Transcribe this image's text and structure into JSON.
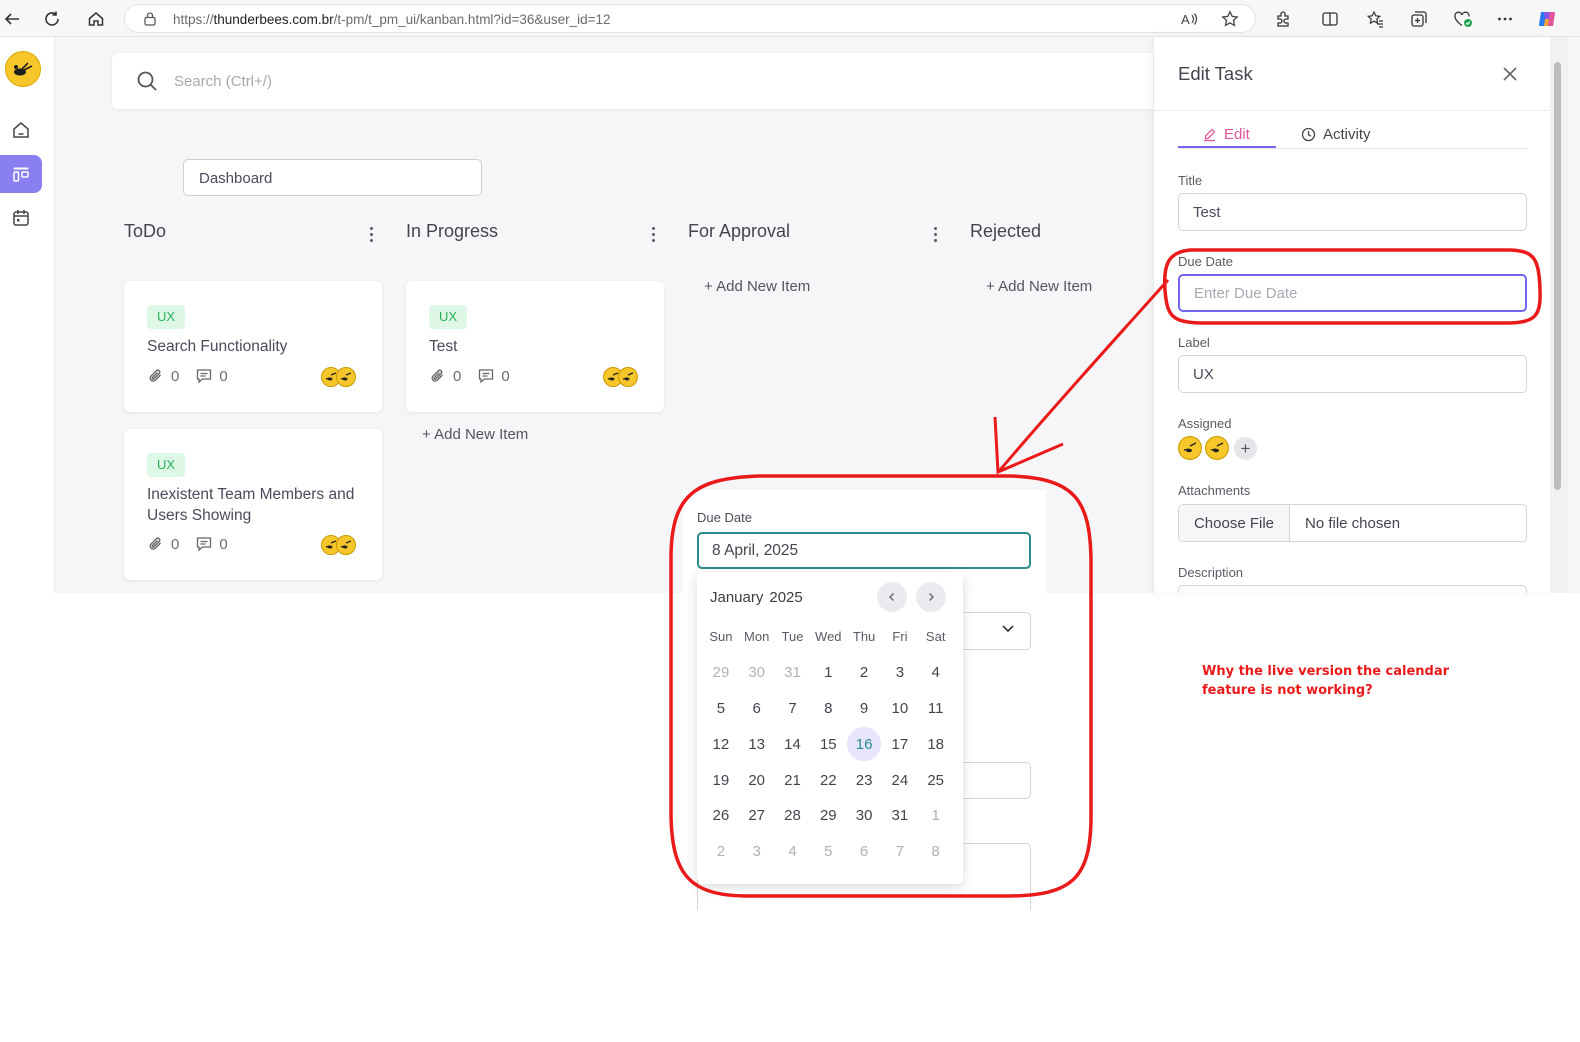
{
  "browser": {
    "url_prefix": "https://",
    "url_domain": "thunderbees.com.br",
    "url_path": "/t-pm/t_pm_ui/kanban.html?id=36&user_id=12"
  },
  "colors": {
    "accent": "#7367f0",
    "badge_text": "#27b15a",
    "badge_bg": "#dff7e6",
    "annotation": "#ea1a1a",
    "avatar": "#f6c62a"
  },
  "search": {
    "placeholder": "Search (Ctrl+/)"
  },
  "board": {
    "selected": "Dashboard"
  },
  "columns": [
    {
      "title": "ToDo"
    },
    {
      "title": "In Progress"
    },
    {
      "title": "For Approval"
    },
    {
      "title": "Rejected"
    }
  ],
  "add_new_item": "+ Add New Item",
  "cards": [
    {
      "label": "UX",
      "title": "Search Functionality",
      "attachments": "0",
      "comments": "0"
    },
    {
      "label": "UX",
      "title": "Inexistent Team Members and Users Showing",
      "attachments": "0",
      "comments": "0"
    },
    {
      "label": "UX",
      "title": "Test",
      "attachments": "0",
      "comments": "0"
    }
  ],
  "drawer": {
    "title": "Edit Task",
    "tabs": [
      {
        "label": "Edit",
        "icon": "pencil-icon"
      },
      {
        "label": "Activity",
        "icon": "clock-icon"
      }
    ],
    "fields": {
      "title_label": "Title",
      "title_value": "Test",
      "due_label": "Due Date",
      "due_placeholder": "Enter Due Date",
      "label_label": "Label",
      "label_value": "UX",
      "assigned_label": "Assigned",
      "attachments_label": "Attachments",
      "choose_file": "Choose File",
      "no_file": "No file chosen",
      "description_label": "Description"
    }
  },
  "inset": {
    "due_label": "Due Date",
    "due_value": "8 April, 2025"
  },
  "calendar": {
    "month": "January",
    "year": "2025",
    "weekdays": [
      "Sun",
      "Mon",
      "Tue",
      "Wed",
      "Thu",
      "Fri",
      "Sat"
    ],
    "selected_day": "16",
    "days": [
      {
        "d": "29",
        "m": true
      },
      {
        "d": "30",
        "m": true
      },
      {
        "d": "31",
        "m": true
      },
      {
        "d": "1"
      },
      {
        "d": "2"
      },
      {
        "d": "3"
      },
      {
        "d": "4"
      },
      {
        "d": "5"
      },
      {
        "d": "6"
      },
      {
        "d": "7"
      },
      {
        "d": "8"
      },
      {
        "d": "9"
      },
      {
        "d": "10"
      },
      {
        "d": "11"
      },
      {
        "d": "12"
      },
      {
        "d": "13"
      },
      {
        "d": "14"
      },
      {
        "d": "15"
      },
      {
        "d": "16",
        "t": true
      },
      {
        "d": "17"
      },
      {
        "d": "18"
      },
      {
        "d": "19"
      },
      {
        "d": "20"
      },
      {
        "d": "21"
      },
      {
        "d": "22"
      },
      {
        "d": "23"
      },
      {
        "d": "24"
      },
      {
        "d": "25"
      },
      {
        "d": "26"
      },
      {
        "d": "27"
      },
      {
        "d": "28"
      },
      {
        "d": "29"
      },
      {
        "d": "30"
      },
      {
        "d": "31"
      },
      {
        "d": "1",
        "m": true
      },
      {
        "d": "2",
        "m": true
      },
      {
        "d": "3",
        "m": true
      },
      {
        "d": "4",
        "m": true
      },
      {
        "d": "5",
        "m": true
      },
      {
        "d": "6",
        "m": true
      },
      {
        "d": "7",
        "m": true
      },
      {
        "d": "8",
        "m": true
      }
    ]
  },
  "annotation": {
    "text": "Why the live version the calendar feature is not working?"
  }
}
